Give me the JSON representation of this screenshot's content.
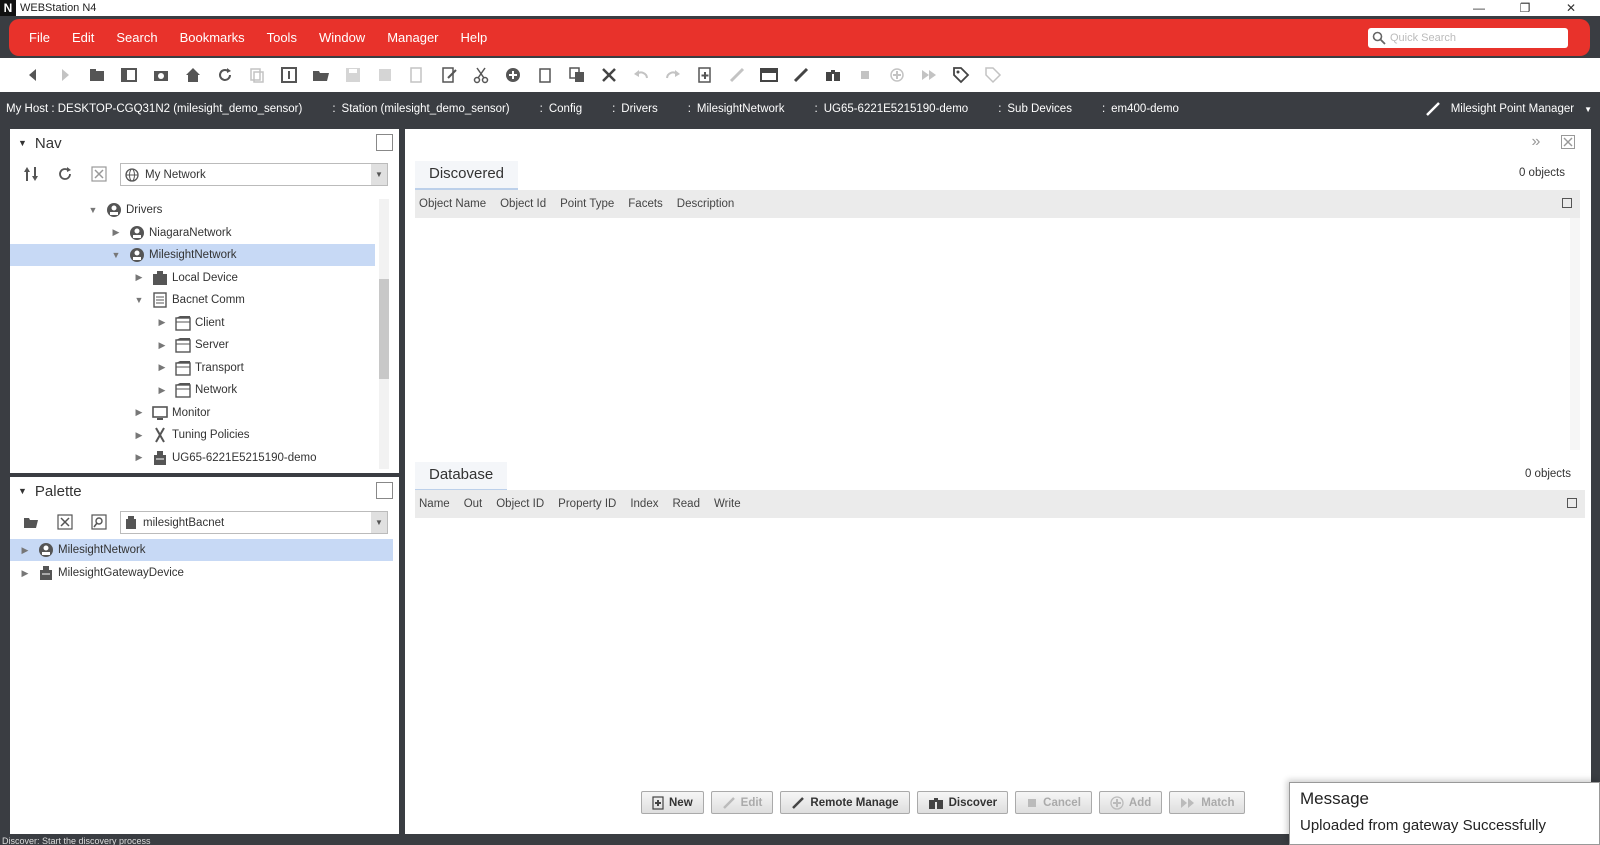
{
  "app": {
    "title": "WEBStation N4",
    "logo": "N"
  },
  "menu": {
    "items": [
      "File",
      "Edit",
      "Search",
      "Bookmarks",
      "Tools",
      "Window",
      "Manager",
      "Help"
    ],
    "search_placeholder": "Quick Search",
    "accent": "#e8322b"
  },
  "breadcrumb": {
    "items": [
      "My Host : DESKTOP-CGQ31N2 (milesight_demo_sensor)",
      "Station (milesight_demo_sensor)",
      "Config",
      "Drivers",
      "MilesightNetwork",
      "UG65-6221E5215190-demo",
      "Sub Devices",
      "em400-demo"
    ],
    "view": "Milesight Point Manager"
  },
  "nav": {
    "title": "Nav",
    "combo": "My Network",
    "tree": [
      {
        "label": "Drivers",
        "indent": 0,
        "state": "open",
        "icon": "driver-icon",
        "selected": false
      },
      {
        "label": "NiagaraNetwork",
        "indent": 1,
        "state": "closed",
        "icon": "network-icon",
        "selected": false
      },
      {
        "label": "MilesightNetwork",
        "indent": 1,
        "state": "open",
        "icon": "network-icon",
        "selected": true
      },
      {
        "label": "Local Device",
        "indent": 2,
        "state": "closed",
        "icon": "device-icon",
        "selected": false
      },
      {
        "label": "Bacnet Comm",
        "indent": 2,
        "state": "open",
        "icon": "comm-icon",
        "selected": false
      },
      {
        "label": "Client",
        "indent": 3,
        "state": "closed",
        "icon": "folder-icon",
        "selected": false
      },
      {
        "label": "Server",
        "indent": 3,
        "state": "closed",
        "icon": "folder-icon",
        "selected": false
      },
      {
        "label": "Transport",
        "indent": 3,
        "state": "closed",
        "icon": "folder-icon",
        "selected": false
      },
      {
        "label": "Network",
        "indent": 3,
        "state": "closed",
        "icon": "folder-icon",
        "selected": false
      },
      {
        "label": "Monitor",
        "indent": 2,
        "state": "closed",
        "icon": "monitor-icon",
        "selected": false
      },
      {
        "label": "Tuning Policies",
        "indent": 2,
        "state": "closed",
        "icon": "tuning-icon",
        "selected": false
      },
      {
        "label": "UG65-6221E5215190-demo",
        "indent": 2,
        "state": "closed",
        "icon": "gateway-icon",
        "selected": false
      }
    ]
  },
  "palette": {
    "title": "Palette",
    "combo": "milesightBacnet",
    "tree": [
      {
        "label": "MilesightNetwork",
        "icon": "network-icon",
        "selected": true
      },
      {
        "label": "MilesightGatewayDevice",
        "icon": "gateway-icon",
        "selected": false
      }
    ]
  },
  "discovered": {
    "title": "Discovered",
    "count": "0 objects",
    "columns": [
      "Object Name",
      "Object Id",
      "Point Type",
      "Facets",
      "Description"
    ]
  },
  "database": {
    "title": "Database",
    "count": "0 objects",
    "columns": [
      "Name",
      "Out",
      "Object ID",
      "Property ID",
      "Index",
      "Read",
      "Write"
    ]
  },
  "buttons": [
    {
      "label": "New",
      "icon": "new-icon",
      "enabled": true
    },
    {
      "label": "Edit",
      "icon": "edit-icon",
      "enabled": false
    },
    {
      "label": "Remote Manage",
      "icon": "remote-manage-icon",
      "enabled": true
    },
    {
      "label": "Discover",
      "icon": "discover-icon",
      "enabled": true
    },
    {
      "label": "Cancel",
      "icon": "cancel-icon",
      "enabled": false
    },
    {
      "label": "Add",
      "icon": "add-icon",
      "enabled": false
    },
    {
      "label": "Match",
      "icon": "match-icon",
      "enabled": false
    }
  ],
  "message": {
    "title": "Message",
    "body": "Uploaded from gateway Successfully"
  },
  "status": "Discover: Start the discovery process"
}
